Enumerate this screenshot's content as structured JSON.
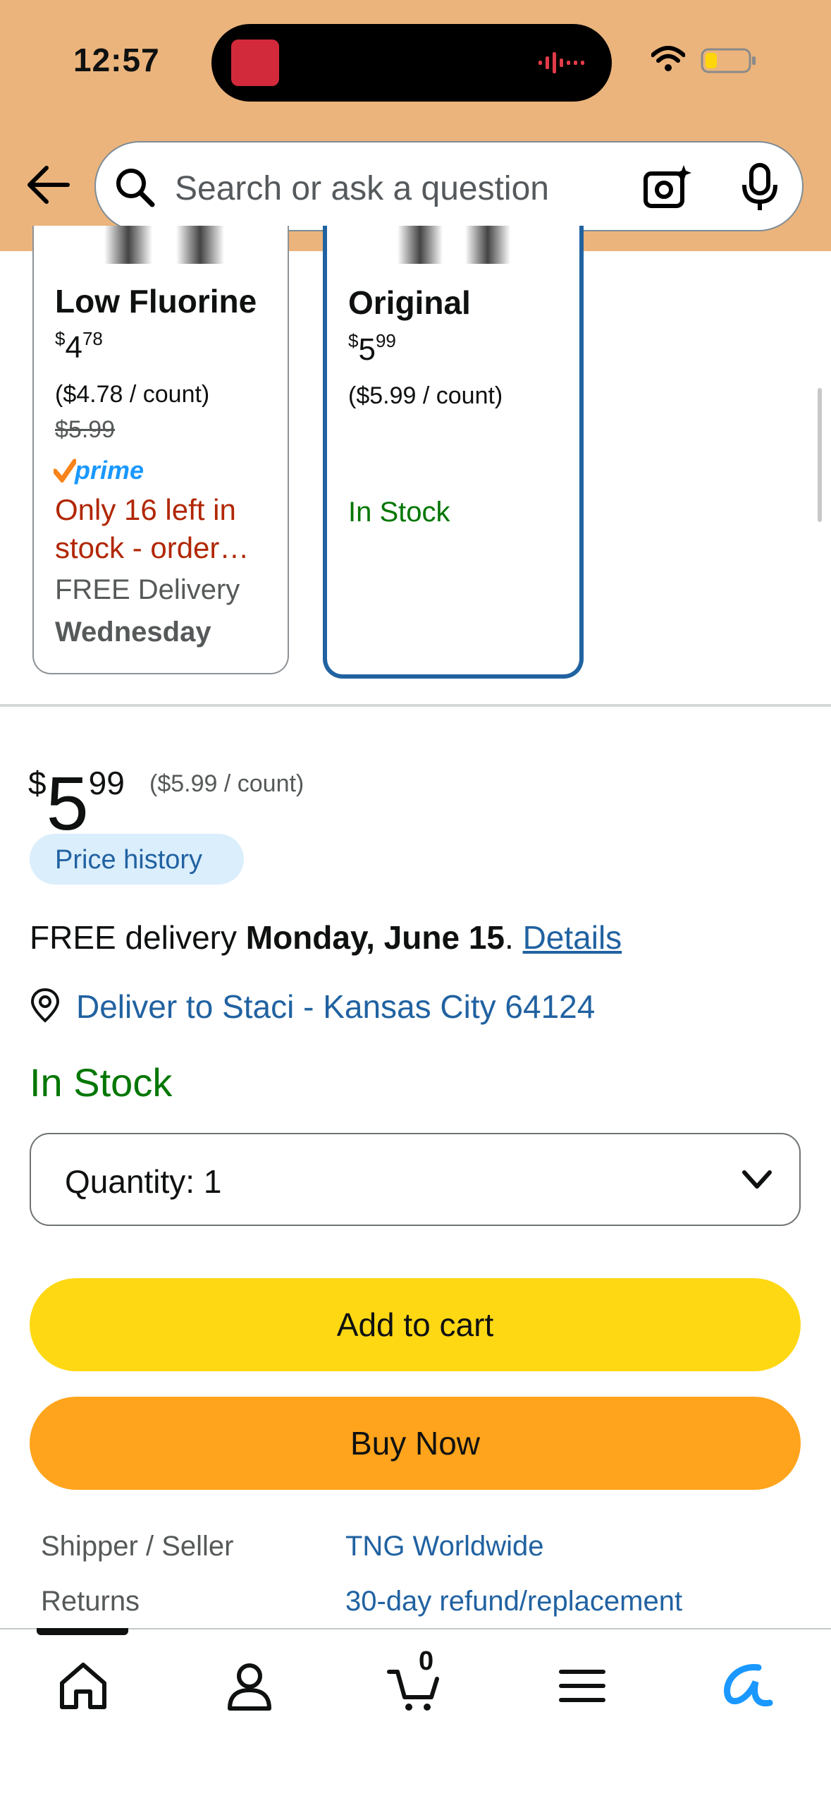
{
  "status_bar": {
    "time": "12:57"
  },
  "search": {
    "placeholder": "Search or ask a question"
  },
  "variants": [
    {
      "title": "Low Fluorine",
      "price_currency": "$",
      "price_whole": "4",
      "price_fraction": "78",
      "unit_price": "($4.78 / count)",
      "list_price": "$5.99",
      "badge": "prime",
      "stock_message": "Only 16 left in stock - order…",
      "delivery_label": "FREE Delivery",
      "delivery_day": "Wednesday"
    },
    {
      "title": "Original",
      "price_currency": "$",
      "price_whole": "5",
      "price_fraction": "99",
      "unit_price": "($5.99 / count)",
      "availability": "In Stock",
      "selected": true
    }
  ],
  "buybox": {
    "currency": "$",
    "price_whole": "5",
    "price_fraction": "99",
    "unit_price": "($5.99 / count)",
    "price_history_label": "Price history",
    "delivery_prefix": "FREE delivery ",
    "delivery_date": "Monday, June 15",
    "delivery_suffix": ". ",
    "details_link": "Details",
    "deliver_to": "Deliver to Staci - Kansas City 64124",
    "availability": "In Stock",
    "quantity_label": "Quantity:  1",
    "add_to_cart": "Add to cart",
    "buy_now": "Buy Now",
    "info": [
      {
        "label": "Shipper / Seller",
        "value": "TNG Worldwide"
      },
      {
        "label": "Returns",
        "value": "30-day refund/replacement"
      }
    ]
  },
  "tabbar": {
    "items": [
      "home-icon",
      "account-icon",
      "cart-icon",
      "menu-icon",
      "assistant-icon"
    ],
    "cart_count": "0"
  },
  "colors": {
    "header_bg": "#ebb47c",
    "link": "#2162a1",
    "in_stock": "#007600",
    "warning": "#b12704",
    "add_to_cart": "#ffd814",
    "buy_now": "#ffa41c",
    "selected_border": "#2162a1"
  }
}
